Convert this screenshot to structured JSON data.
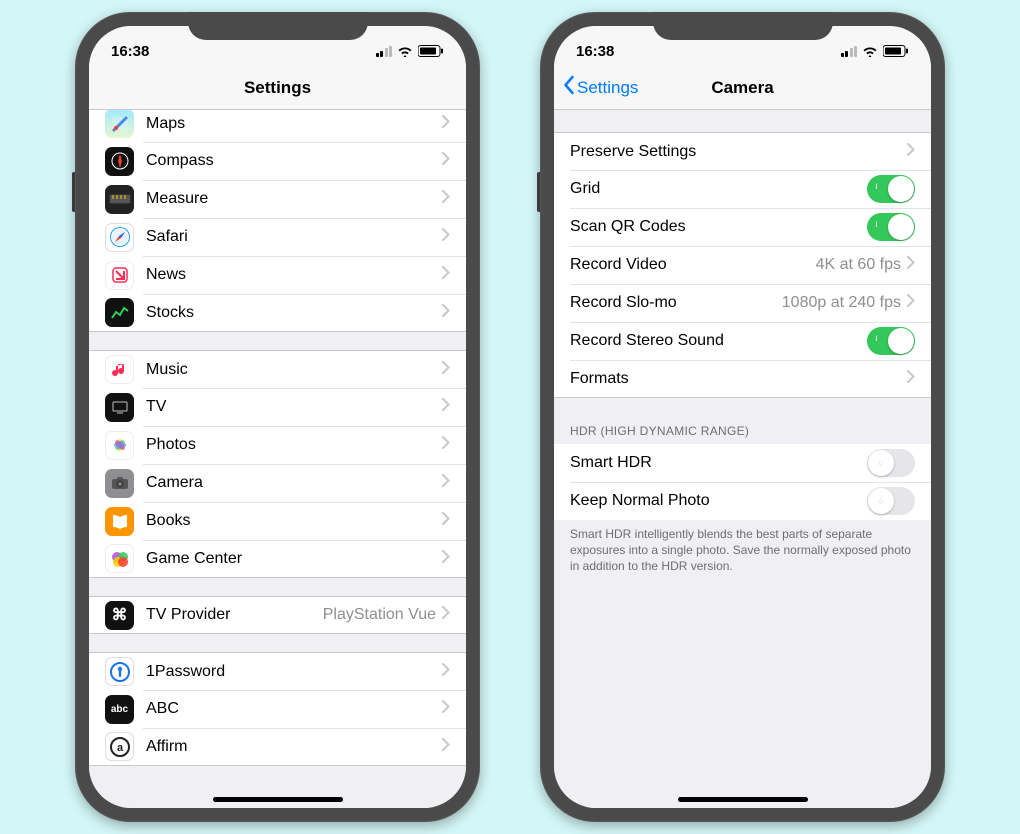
{
  "status": {
    "time": "16:38"
  },
  "left": {
    "title": "Settings",
    "groups": [
      {
        "items": [
          {
            "icon": "maps",
            "label": "Maps"
          },
          {
            "icon": "compass",
            "label": "Compass"
          },
          {
            "icon": "measure",
            "label": "Measure"
          },
          {
            "icon": "safari",
            "label": "Safari"
          },
          {
            "icon": "news",
            "label": "News"
          },
          {
            "icon": "stocks",
            "label": "Stocks"
          }
        ]
      },
      {
        "items": [
          {
            "icon": "music",
            "label": "Music"
          },
          {
            "icon": "tv",
            "label": "TV"
          },
          {
            "icon": "photos",
            "label": "Photos"
          },
          {
            "icon": "camera",
            "label": "Camera"
          },
          {
            "icon": "books",
            "label": "Books"
          },
          {
            "icon": "gc",
            "label": "Game Center"
          }
        ]
      },
      {
        "items": [
          {
            "icon": "tvp",
            "label": "TV Provider",
            "value": "PlayStation Vue"
          }
        ]
      },
      {
        "items": [
          {
            "icon": "1pw",
            "label": "1Password"
          },
          {
            "icon": "abc",
            "label": "ABC"
          },
          {
            "icon": "affirm",
            "label": "Affirm"
          }
        ]
      }
    ]
  },
  "right": {
    "back": "Settings",
    "title": "Camera",
    "groups": [
      {
        "items": [
          {
            "label": "Preserve Settings",
            "type": "chevron"
          },
          {
            "label": "Grid",
            "type": "toggle",
            "on": true
          },
          {
            "label": "Scan QR Codes",
            "type": "toggle",
            "on": true
          },
          {
            "label": "Record Video",
            "type": "chevron",
            "value": "4K at 60 fps"
          },
          {
            "label": "Record Slo-mo",
            "type": "chevron",
            "value": "1080p at 240 fps"
          },
          {
            "label": "Record Stereo Sound",
            "type": "toggle",
            "on": true
          },
          {
            "label": "Formats",
            "type": "chevron"
          }
        ]
      },
      {
        "header": "HDR (HIGH DYNAMIC RANGE)",
        "items": [
          {
            "label": "Smart HDR",
            "type": "toggle",
            "on": false
          },
          {
            "label": "Keep Normal Photo",
            "type": "toggle",
            "on": false
          }
        ],
        "footer": "Smart HDR intelligently blends the best parts of separate exposures into a single photo. Save the normally exposed photo in addition to the HDR version."
      }
    ]
  }
}
